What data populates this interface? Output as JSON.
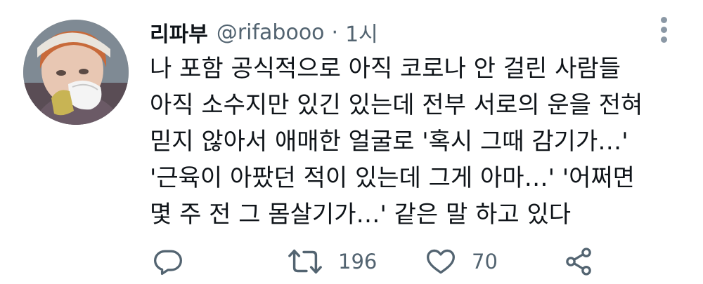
{
  "author": {
    "display_name": "리파부",
    "handle": "@rifabooo",
    "separator": "·",
    "time": "1시"
  },
  "tweet": {
    "lines": [
      "나 포함 공식적으로 아직 코로나 안 걸린 사람들",
      "아직 소수지만 있긴 있는데 전부 서로의 운을 전혀",
      "믿지 않아서 애매한 얼굴로 '혹시 그때 감기가…'",
      "'근육이 아팠던 적이 있는데 그게 아마…' '어쩌면",
      "몇 주 전 그 몸살기가…' 같은 말 하고 있다"
    ]
  },
  "actions": {
    "reply_icon": "reply-icon",
    "retweet_icon": "retweet-icon",
    "retweet_count": "196",
    "like_icon": "heart-icon",
    "like_count": "70",
    "share_icon": "share-icon"
  },
  "colors": {
    "text": "#0f1419",
    "secondary": "#536471",
    "background": "#ffffff"
  }
}
